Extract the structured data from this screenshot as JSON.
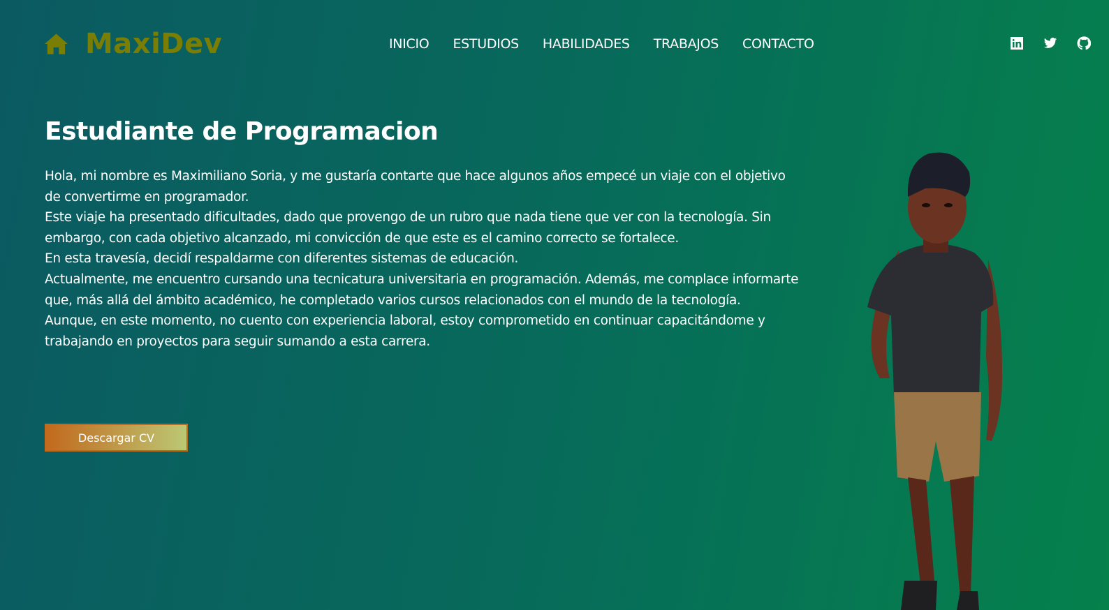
{
  "header": {
    "logo_text": "MaxiDev",
    "logo_icon": "home-icon",
    "nav": [
      "INICIO",
      "ESTUDIOS",
      "HABILIDADES",
      "TRABAJOS",
      "CONTACTO"
    ],
    "social": [
      "linkedin-icon",
      "twitter-icon",
      "github-icon"
    ]
  },
  "hero": {
    "title": "Estudiante de Programacion",
    "paragraphs": [
      "Hola, mi nombre es Maximiliano Soria, y me gustaría contarte que hace algunos años empecé un viaje con el objetivo de convertirme en programador.",
      "Este viaje ha presentado dificultades, dado que provengo de un rubro que nada tiene que ver con la tecnología. Sin embargo, con cada objetivo alcanzado, mi convicción de que este es el camino correcto se fortalece.",
      "En esta travesía, decidí respaldarme con diferentes sistemas de educación.",
      "Actualmente, me encuentro cursando una tecnicatura universitaria en programación. Además, me complace informarte que, más allá del ámbito académico, he completado varios cursos relacionados con el mundo de la tecnología.",
      "Aunque, en este momento, no cuento con experiencia laboral, estoy comprometido en continuar capacitándome y trabajando en proyectos para seguir sumando a esta carrera."
    ],
    "cv_button": "Descargar CV"
  },
  "colors": {
    "logo": "#7a7e05",
    "bg_left": "#0b5a62",
    "bg_right": "#05814c",
    "button_start": "#c2691d",
    "button_end": "#bcc874"
  }
}
